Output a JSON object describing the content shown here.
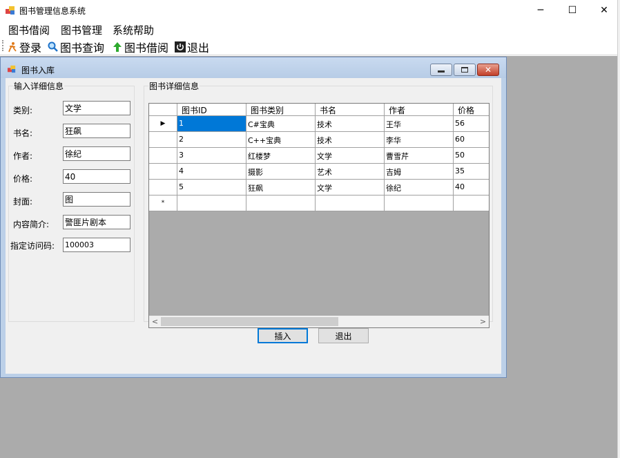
{
  "window": {
    "title": "图书管理信息系统",
    "controls": {
      "minimize": "─",
      "maximize": "☐",
      "close": "✕"
    }
  },
  "menubar": {
    "items": [
      "图书借阅",
      "图书管理",
      "系统帮助"
    ]
  },
  "toolbar": {
    "items": [
      {
        "label": "登录",
        "icon": "person-run-icon"
      },
      {
        "label": "图书查询",
        "icon": "magnifier-icon"
      },
      {
        "label": "图书借阅",
        "icon": "green-up-arrow-icon"
      },
      {
        "label": "退出",
        "icon": "power-icon"
      }
    ]
  },
  "child_window": {
    "title": "图书入库",
    "form": {
      "group_title": "输入详细信息",
      "fields": [
        {
          "label": "类别:",
          "value": "文学"
        },
        {
          "label": "书名:",
          "value": "狂飙"
        },
        {
          "label": "作者:",
          "value": "徐纪"
        },
        {
          "label": "价格:",
          "value": "40"
        },
        {
          "label": "封面:",
          "value": "图"
        },
        {
          "label": "内容简介:",
          "value": "警匪片剧本"
        },
        {
          "label": "指定访问码:",
          "value": "100003"
        }
      ]
    },
    "grid": {
      "group_title": "图书详细信息",
      "columns": [
        "图书ID",
        "图书类别",
        "书名",
        "作者",
        "价格"
      ],
      "rows": [
        [
          "1",
          "C#宝典",
          "技术",
          "王华",
          "56"
        ],
        [
          "2",
          "C++宝典",
          "技术",
          "李华",
          "60"
        ],
        [
          "3",
          "红楼梦",
          "文学",
          "曹雪芹",
          "50"
        ],
        [
          "4",
          "摄影",
          "艺术",
          "吉姆",
          "35"
        ],
        [
          "5",
          "狂飙",
          "文学",
          "徐纪",
          "40"
        ]
      ],
      "current_row_marker": "▶",
      "new_row_marker": "*"
    },
    "buttons": {
      "insert": "插入",
      "exit": "退出"
    }
  },
  "colors": {
    "selection": "#0078d7",
    "mdi_background": "#ababab",
    "child_titlebar": "#bcd0e8"
  }
}
